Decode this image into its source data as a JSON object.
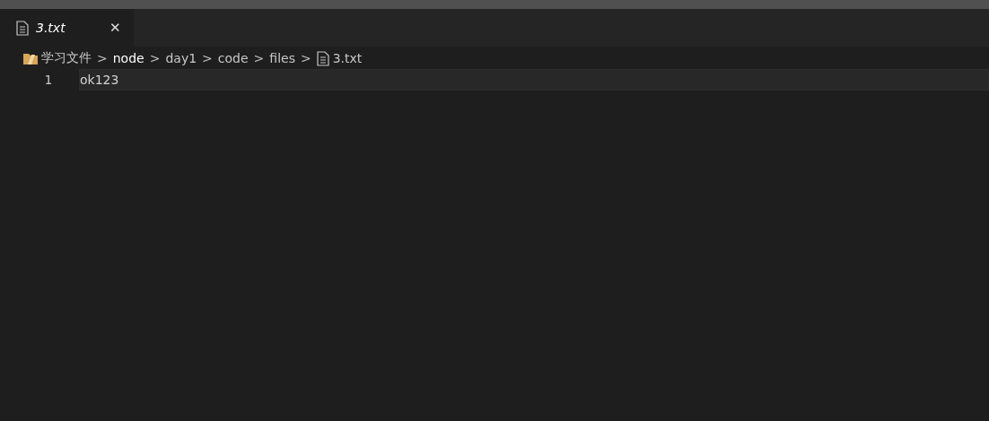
{
  "tabs": [
    {
      "label": "3.txt",
      "selected": true,
      "italic": true
    }
  ],
  "breadcrumb": [
    {
      "label": "学习文件",
      "kind": "folder",
      "selected": false
    },
    {
      "label": "node",
      "kind": "plain",
      "selected": true
    },
    {
      "label": "day1",
      "kind": "plain",
      "selected": false
    },
    {
      "label": "code",
      "kind": "plain",
      "selected": false
    },
    {
      "label": "files",
      "kind": "plain",
      "selected": false
    },
    {
      "label": "3.txt",
      "kind": "file",
      "selected": false
    }
  ],
  "separator": ">",
  "close_glyph": "✕",
  "lines": [
    {
      "number": "1",
      "text": "ok123",
      "current": true
    }
  ]
}
